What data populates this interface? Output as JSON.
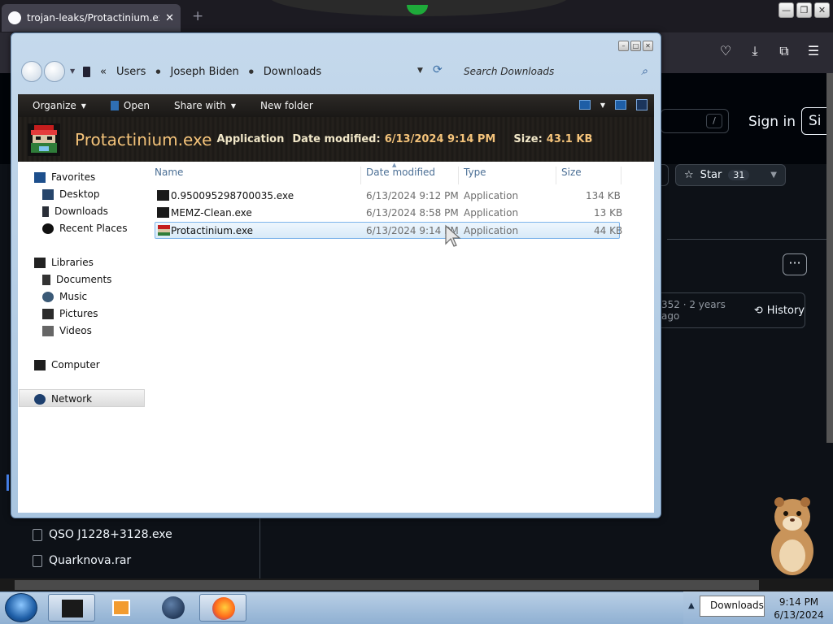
{
  "browser": {
    "tab_title": "trojan-leaks/Protactinium.exe a",
    "tab_close": "✕",
    "new_tab": "+"
  },
  "github": {
    "sign_in": "Sign in",
    "sign_up_partial": "Si",
    "slash_key": "/",
    "star_label": "Star",
    "star_count": "31",
    "more": "···",
    "commit_meta": "352 · 2 years ago",
    "history_label": "History",
    "files": [
      "QSO J1228+3128.exe",
      "Quarknova.rar"
    ]
  },
  "explorer": {
    "breadcrumb": [
      "Users",
      "Joseph Biden",
      "Downloads"
    ],
    "breadcrumb_lead": "«",
    "search_placeholder": "Search Downloads",
    "toolbar": {
      "organize": "Organize",
      "open": "Open",
      "share_with": "Share with",
      "new_folder": "New folder"
    },
    "details": {
      "name": "Protactinium.exe",
      "type": "Application",
      "date_label": "Date modified:",
      "date_value": "6/13/2024 9:14 PM",
      "size_label": "Size:",
      "size_value": "43.1 KB"
    },
    "nav_pane": {
      "favorites": "Favorites",
      "desktop": "Desktop",
      "downloads": "Downloads",
      "recent_places": "Recent Places",
      "libraries": "Libraries",
      "documents": "Documents",
      "music": "Music",
      "pictures": "Pictures",
      "videos": "Videos",
      "computer": "Computer",
      "network": "Network"
    },
    "columns": {
      "name": "Name",
      "date_modified": "Date modified",
      "type": "Type",
      "size": "Size"
    },
    "files": [
      {
        "name": "0.950095298700035.exe",
        "date": "6/13/2024 9:12 PM",
        "type": "Application",
        "size": "134 KB"
      },
      {
        "name": "MEMZ-Clean.exe",
        "date": "6/13/2024 8:58 PM",
        "type": "Application",
        "size": "13 KB"
      },
      {
        "name": "Protactinium.exe",
        "date": "6/13/2024 9:14 PM",
        "type": "Application",
        "size": "44 KB",
        "selected": true
      }
    ]
  },
  "taskbar": {
    "tray_tooltip": "Downloads",
    "time": "9:14 PM",
    "date": "6/13/2024"
  },
  "colors": {
    "accent": "#3a6ea5",
    "details_text": "#f4c37a",
    "github_bg": "#0d1117"
  }
}
